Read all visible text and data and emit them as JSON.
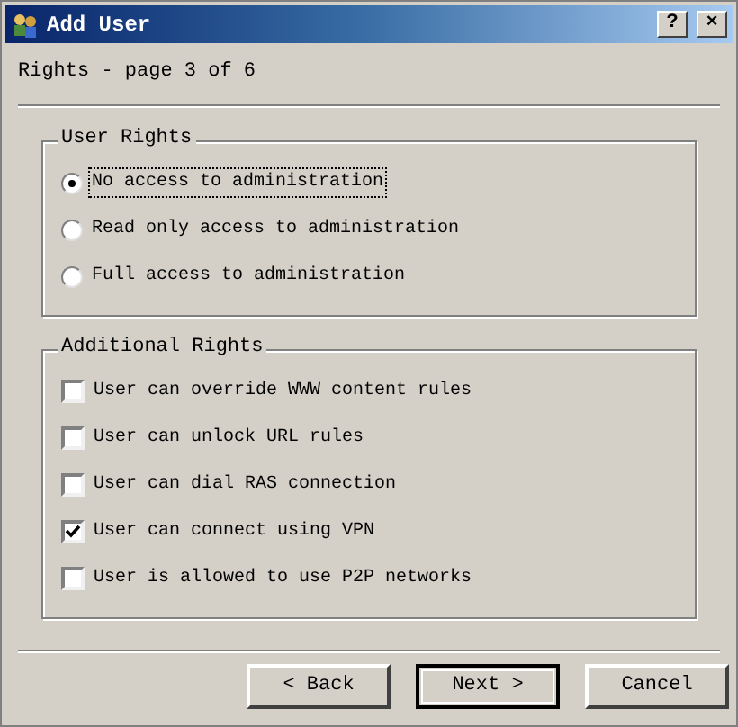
{
  "window": {
    "title": "Add User",
    "title_buttons": [
      "?",
      "×"
    ]
  },
  "header": "Rights - page 3 of 6",
  "user_rights": {
    "title": "User Rights",
    "options": [
      {
        "label": "No access to administration",
        "selected": true
      },
      {
        "label": "Read only access to administration",
        "selected": false
      },
      {
        "label": "Full access to administration",
        "selected": false
      }
    ]
  },
  "additional_rights": {
    "title": "Additional Rights",
    "items": [
      {
        "label": "User can override WWW content rules",
        "checked": false
      },
      {
        "label": "User can unlock URL rules",
        "checked": false
      },
      {
        "label": "User can dial RAS connection",
        "checked": false
      },
      {
        "label": "User can connect using VPN",
        "checked": true
      },
      {
        "label": "User is allowed to use P2P networks",
        "checked": false
      }
    ]
  },
  "buttons": [
    {
      "label": "< Back",
      "default": false
    },
    {
      "label": "Next >",
      "default": true
    },
    {
      "label": "Cancel",
      "default": false
    }
  ]
}
